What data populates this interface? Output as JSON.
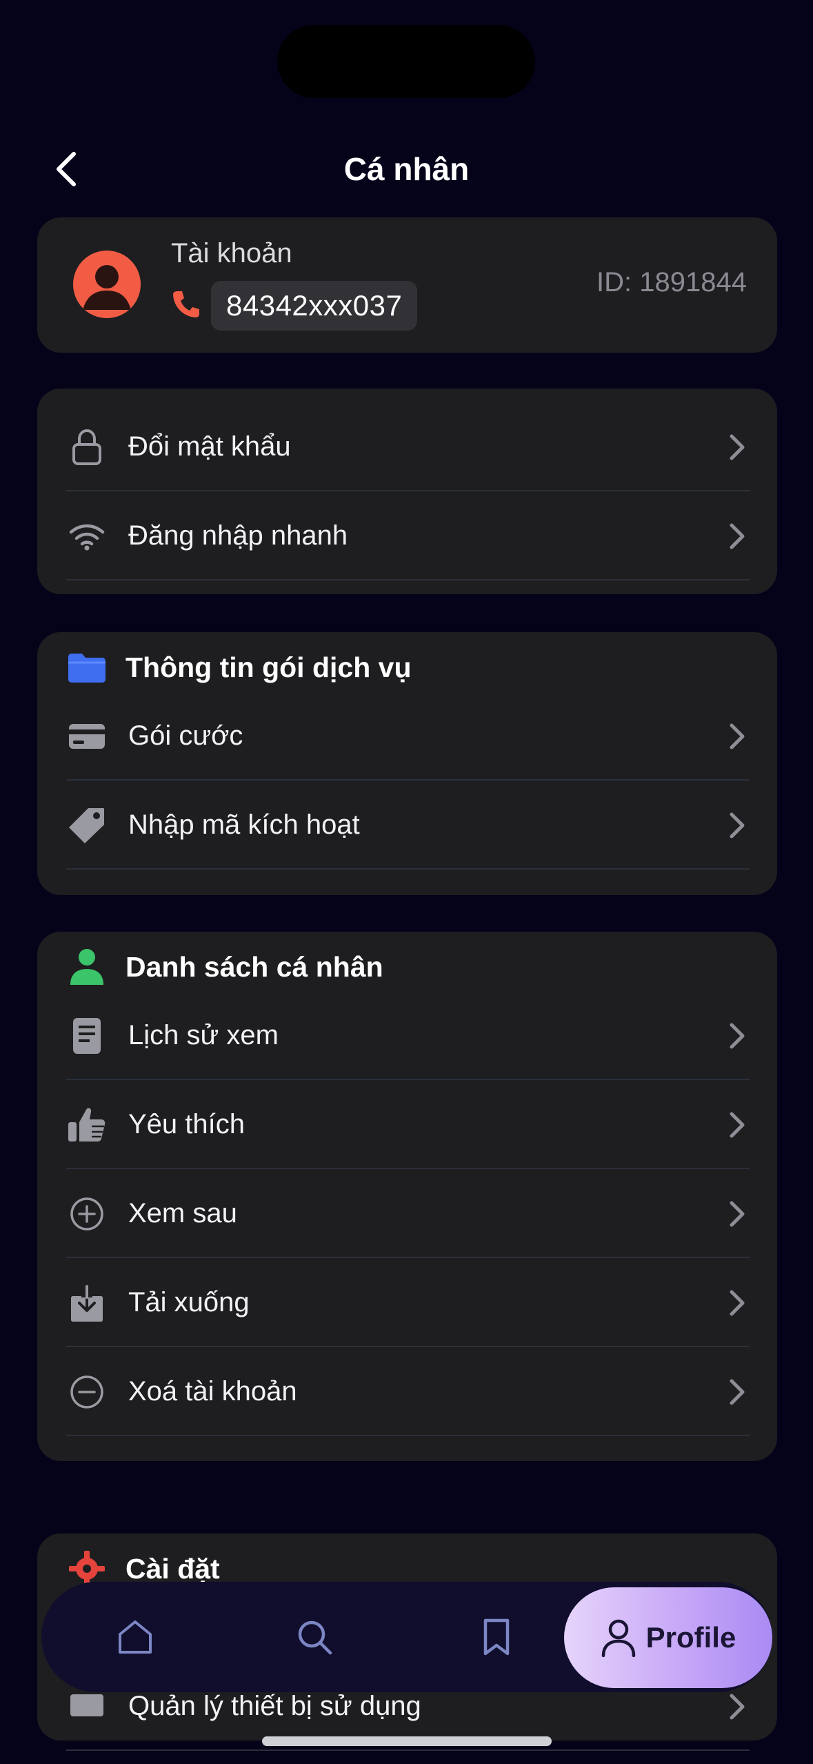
{
  "header": {
    "title": "Cá nhân"
  },
  "account": {
    "label": "Tài khoản",
    "phone": "84342xxx037",
    "id": "ID: 1891844"
  },
  "security": {
    "items": [
      {
        "label": "Đổi mật khẩu",
        "icon": "lock-icon"
      },
      {
        "label": "Đăng nhập nhanh",
        "icon": "wifi-icon"
      }
    ]
  },
  "service": {
    "title": "Thông tin gói dịch vụ",
    "icon": "folder-icon",
    "items": [
      {
        "label": "Gói cước",
        "icon": "card-icon"
      },
      {
        "label": "Nhập mã kích hoạt",
        "icon": "tag-icon"
      }
    ]
  },
  "personal": {
    "title": "Danh sách cá nhân",
    "icon": "person-icon",
    "items": [
      {
        "label": "Lịch sử xem",
        "icon": "document-icon"
      },
      {
        "label": "Yêu thích",
        "icon": "thumbs-up-icon"
      },
      {
        "label": "Xem sau",
        "icon": "plus-circle-icon"
      },
      {
        "label": "Tải xuống",
        "icon": "download-icon"
      },
      {
        "label": "Xoá tài khoản",
        "icon": "minus-circle-icon"
      }
    ]
  },
  "settings": {
    "title": "Cài đặt",
    "icon": "gear-icon",
    "partial_item": "Quản lý thiết bị sử dụng"
  },
  "nav": {
    "items": [
      "home-icon",
      "search-icon",
      "bookmark-icon"
    ],
    "profile_label": "Profile"
  },
  "colors": {
    "background": "#05031a",
    "card": "#1e1e20",
    "accent_orange": "#f25c45",
    "folder_blue": "#3f6ff0",
    "person_green": "#3cc46b",
    "gear_red": "#e5443c",
    "nav_profile_gradient": [
      "#e6d4fb",
      "#a98bf3"
    ]
  }
}
